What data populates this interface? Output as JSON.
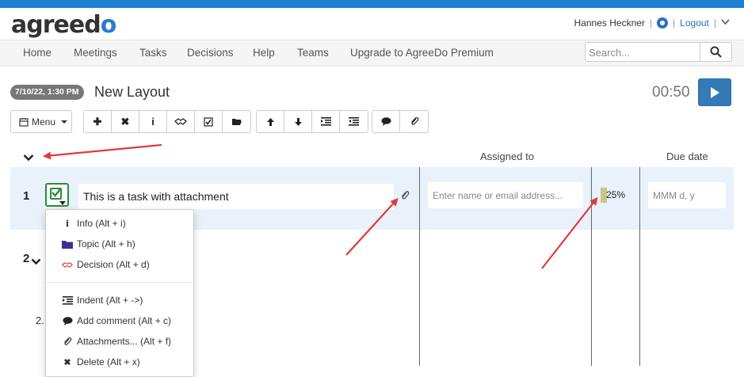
{
  "app": {
    "logo_main": "agreed",
    "logo_tail": "o"
  },
  "user": {
    "name": "Hannes Heckner",
    "logout": "Logout"
  },
  "nav": [
    "Home",
    "Meetings",
    "Tasks",
    "Decisions",
    "Help",
    "Teams",
    "Upgrade to AgreeDo Premium"
  ],
  "search": {
    "placeholder": "Search..."
  },
  "meeting": {
    "date": "7/10/22, 1:30 PM",
    "title": "New Layout",
    "timer": "00:50"
  },
  "toolbar": {
    "menu_label": "Menu"
  },
  "columns": {
    "assigned": "Assigned to",
    "due": "Due date"
  },
  "task": {
    "number": "1",
    "text": "This is a task with attachment",
    "assign_placeholder": "Enter name or email address...",
    "progress_label": "25%",
    "progress_value": 0.25,
    "due_placeholder": "MMM d, y"
  },
  "row2": {
    "number": "2"
  },
  "row_sub": {
    "number": "2."
  },
  "dropdown": {
    "items": [
      {
        "label": "Info (Alt + i)",
        "icon": "info-icon"
      },
      {
        "label": "Topic (Alt + h)",
        "icon": "folder-icon"
      },
      {
        "label": "Decision (Alt + d)",
        "icon": "handshake-icon"
      },
      {
        "label": "Indent (Alt + ->)",
        "icon": "indent-icon"
      },
      {
        "label": "Add comment (Alt + c)",
        "icon": "comment-icon"
      },
      {
        "label": "Attachments... (Alt + f)",
        "icon": "paperclip-icon"
      },
      {
        "label": "Delete (Alt + x)",
        "icon": "delete-icon"
      }
    ]
  },
  "colors": {
    "brand": "#1f7fd0",
    "check": "#2e8b3e",
    "arrow": "#e03a3a",
    "decision": "#d9342b",
    "topic": "#3b2f8f"
  }
}
